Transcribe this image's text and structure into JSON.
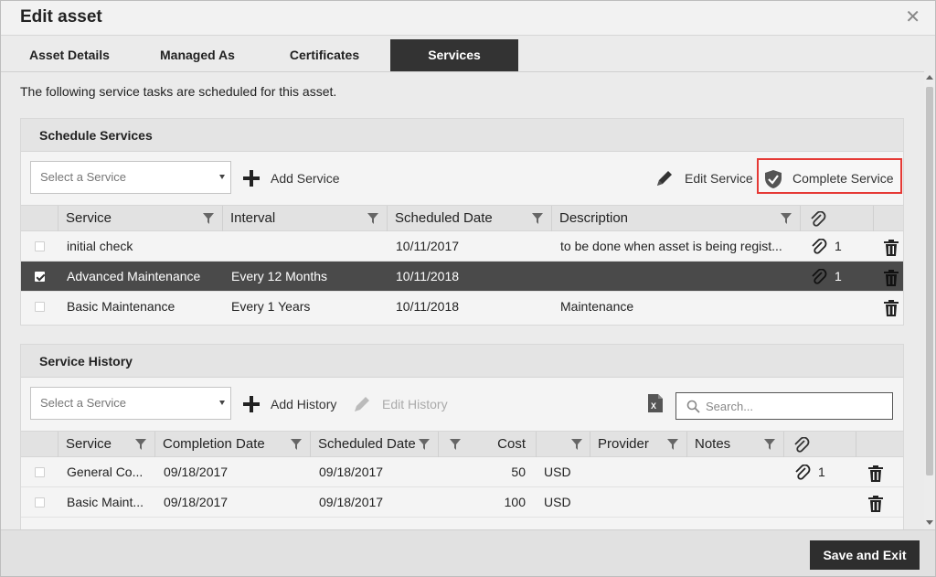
{
  "dialog": {
    "title": "Edit asset"
  },
  "tabs": [
    {
      "label": "Asset Details"
    },
    {
      "label": "Managed As"
    },
    {
      "label": "Certificates"
    },
    {
      "label": "Services"
    }
  ],
  "intro_text": "The following service tasks are scheduled for this asset.",
  "schedule": {
    "title": "Schedule Services",
    "select_placeholder": "Select a Service",
    "add_label": "Add Service",
    "edit_label": "Edit Service",
    "complete_label": "Complete Service",
    "columns": [
      "Service",
      "Interval",
      "Scheduled Date",
      "Description"
    ],
    "rows": [
      {
        "service": "initial check",
        "interval": "",
        "date": "10/11/2017",
        "description": "to be done when asset is being regist...",
        "attachments": "1",
        "selected": false
      },
      {
        "service": "Advanced Maintenance",
        "interval": "Every 12 Months",
        "date": "10/11/2018",
        "description": "",
        "attachments": "1",
        "selected": true
      },
      {
        "service": "Basic Maintenance",
        "interval": "Every 1 Years",
        "date": "10/11/2018",
        "description": "Maintenance",
        "attachments": "",
        "selected": false
      }
    ]
  },
  "history": {
    "title": "Service History",
    "select_placeholder": "Select a Service",
    "add_label": "Add History",
    "edit_label": "Edit History",
    "search_placeholder": "Search...",
    "columns": [
      "Service",
      "Completion Date",
      "Scheduled Date",
      "Cost",
      "Provider",
      "Notes"
    ],
    "rows": [
      {
        "service": "General Co...",
        "completion": "09/18/2017",
        "scheduled": "09/18/2017",
        "cost": "50",
        "currency": "USD",
        "attachments": "1"
      },
      {
        "service": "Basic Maint...",
        "completion": "09/18/2017",
        "scheduled": "09/18/2017",
        "cost": "100",
        "currency": "USD",
        "attachments": ""
      }
    ]
  },
  "footer": {
    "save_label": "Save and Exit"
  },
  "colors": {
    "highlight_border": "#e53935",
    "selected_row": "#4a4a4a",
    "active_tab": "#333333"
  },
  "icons": [
    "close-icon",
    "plus-icon",
    "pencil-icon",
    "shield-check-icon",
    "filter-icon",
    "paperclip-icon",
    "trash-icon",
    "excel-export-icon",
    "search-icon"
  ]
}
